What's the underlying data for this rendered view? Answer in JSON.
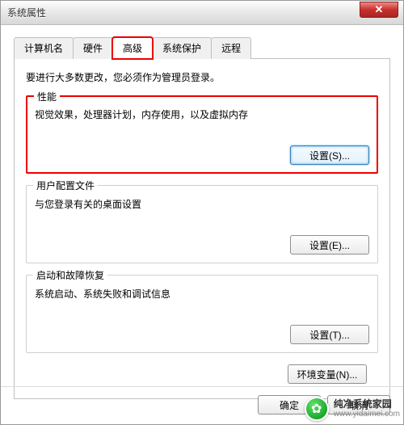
{
  "window": {
    "title": "系统属性"
  },
  "tabs": [
    {
      "label": "计算机名",
      "active": false
    },
    {
      "label": "硬件",
      "active": false
    },
    {
      "label": "高级",
      "active": true,
      "highlighted": true
    },
    {
      "label": "系统保护",
      "active": false
    },
    {
      "label": "远程",
      "active": false
    }
  ],
  "panel": {
    "intro": "要进行大多数更改，您必须作为管理员登录。",
    "groups": {
      "performance": {
        "title": "性能",
        "desc": "视觉效果，处理器计划，内存使用，以及虚拟内存",
        "button": "设置(S)...",
        "highlighted": true,
        "button_focused": true
      },
      "profiles": {
        "title": "用户配置文件",
        "desc": "与您登录有关的桌面设置",
        "button": "设置(E)..."
      },
      "startup": {
        "title": "启动和故障恢复",
        "desc": "系统启动、系统失败和调试信息",
        "button": "设置(T)..."
      }
    },
    "env_button": "环境变量(N)..."
  },
  "dialog": {
    "ok": "确定",
    "cancel": "取消"
  },
  "watermark": {
    "brand": "纯净系统家园",
    "url": "www.yidaimei.com"
  }
}
